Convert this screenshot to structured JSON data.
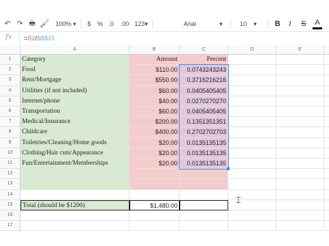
{
  "toolbar": {
    "zoom": "100%",
    "currency": "$",
    "percent": "%",
    "decimal_decrease": ".0",
    "decimal_increase": ".00",
    "more_formats": "123",
    "font": "Arial",
    "font_size": "10",
    "bold": "B",
    "italic": "I",
    "strikethrough": "S",
    "text_color": "A"
  },
  "formula_bar": {
    "fx": "fx",
    "formula_prefix": "=",
    "ref1": "B2",
    "slash": "/",
    "ref2": "$B$15"
  },
  "columns": [
    "A",
    "B",
    "C",
    "D",
    "E"
  ],
  "rows": [
    "1",
    "2",
    "3",
    "4",
    "5",
    "6",
    "7",
    "8",
    "9",
    "10",
    "11",
    "12",
    "13",
    "14",
    "15",
    "16",
    "17"
  ],
  "table": {
    "header": {
      "category": "Category",
      "amount": "Amount",
      "percent": "Percent"
    },
    "items": [
      {
        "category": "Food",
        "amount": "$110.00",
        "percent": "0.0743243243"
      },
      {
        "category": "Rent/Mortgage",
        "amount": "$550.00",
        "percent": "0.3716216216"
      },
      {
        "category": "Utilities (if not included)",
        "amount": "$60.00",
        "percent": "0.0405405405"
      },
      {
        "category": "Internet/phone",
        "amount": "$40.00",
        "percent": "0.0270270270"
      },
      {
        "category": "Transportation",
        "amount": "$60.00",
        "percent": "0.0405405405"
      },
      {
        "category": "Medical/Insurance",
        "amount": "$200.00",
        "percent": "0.1351351351"
      },
      {
        "category": "Childcare",
        "amount": "$400.00",
        "percent": "0.2702702703"
      },
      {
        "category": "Toiletries/Cleaning/Home goods",
        "amount": "$20.00",
        "percent": "0.0135135135"
      },
      {
        "category": "Clothing/Hair cuts/Appearance",
        "amount": "$20.00",
        "percent": "0.0135135135"
      },
      {
        "category": "Fun/Entertainment/Memberships",
        "amount": "$20.00",
        "percent": "0.0135135135"
      }
    ],
    "total": {
      "label": "Total (should be $1200)",
      "amount": "$1,480.00"
    }
  },
  "colors": {
    "category_fill": "#d9ead3",
    "amount_fill": "#f4cccc",
    "selection": "#4a86e8"
  }
}
